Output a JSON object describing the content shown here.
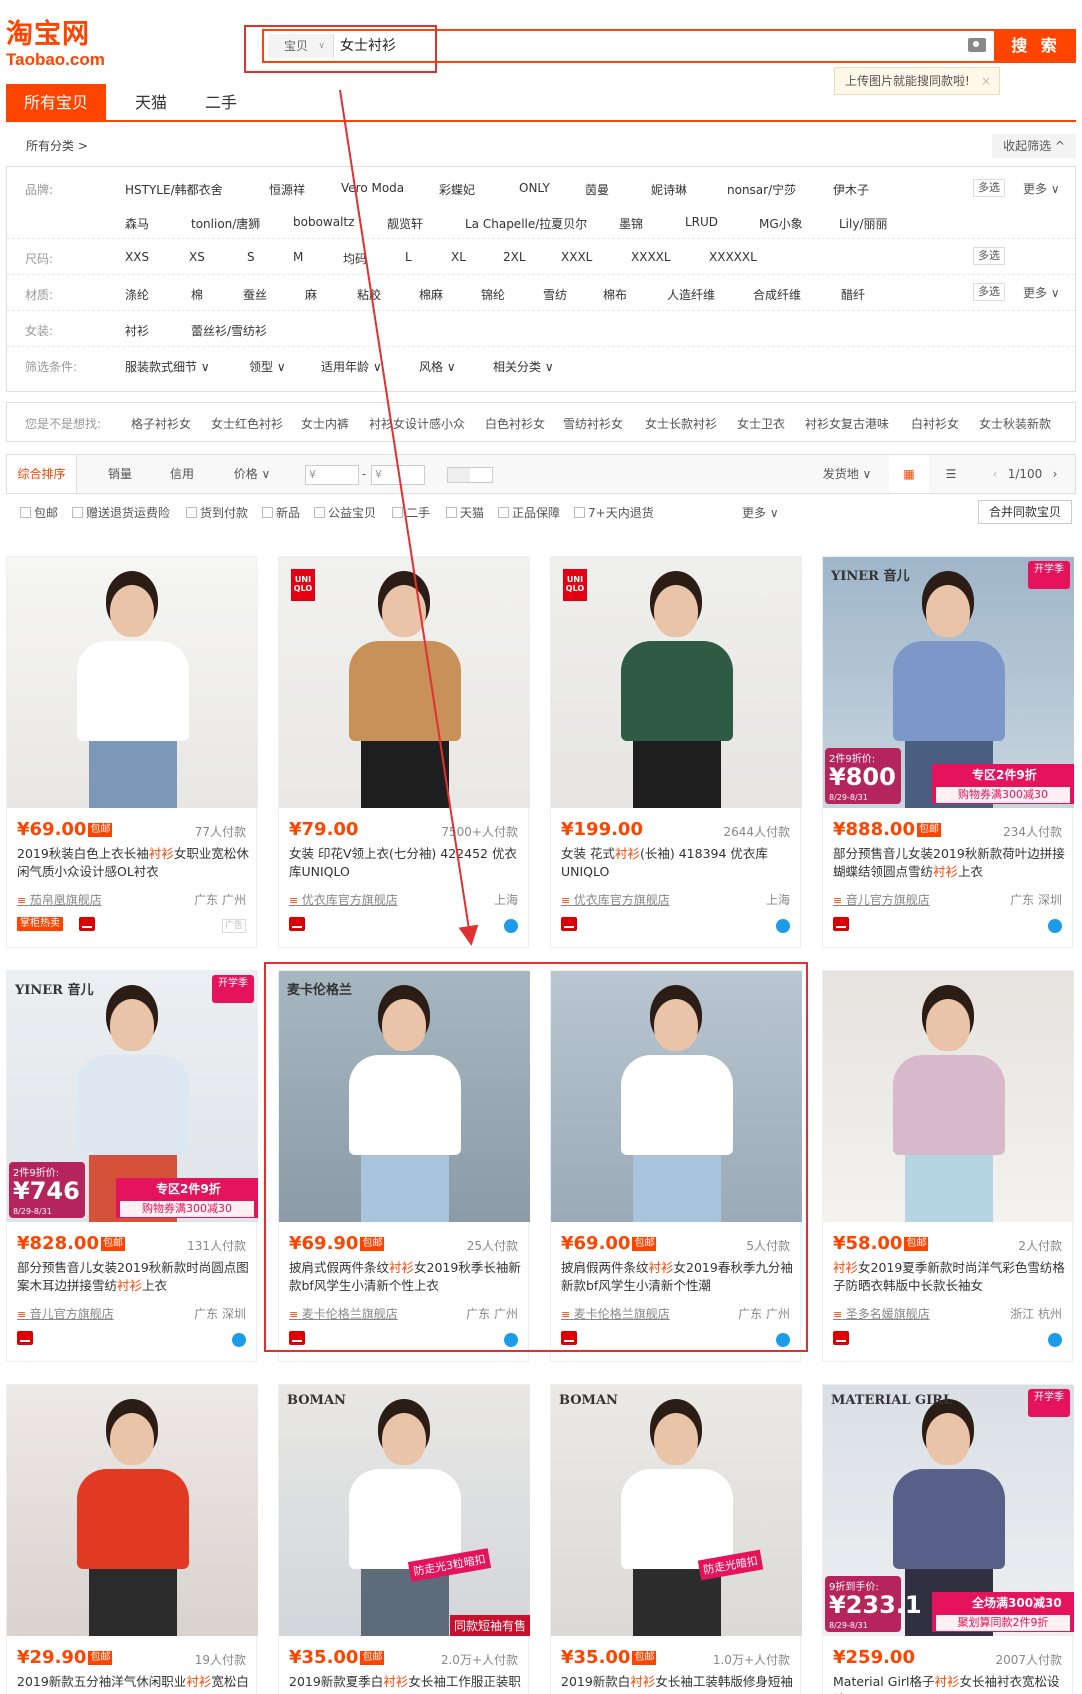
{
  "header": {
    "logo_cn": "淘宝网",
    "logo_en": "Taobao.com",
    "search_scope": "宝贝",
    "search_query": "女士衬衫",
    "search_button": "搜 索",
    "tip": "上传图片就能搜同款啦!",
    "tip_close": "×"
  },
  "tabs": [
    {
      "label": "所有宝贝"
    },
    {
      "label": "天猫"
    },
    {
      "label": "二手"
    }
  ],
  "category": {
    "all": "所有分类 >",
    "collapse": "收起筛选 ^"
  },
  "filters": {
    "brand_label": "品牌:",
    "brands_row1": [
      "HSTYLE/韩都衣舍",
      "恒源祥",
      "Vero Moda",
      "彩蝶妃",
      "ONLY",
      "茵曼",
      "妮诗琳",
      "nonsar/宁莎",
      "伊木子"
    ],
    "brands_row2": [
      "森马",
      "tonlion/唐狮",
      "bobowaltz",
      "靓览轩",
      "La Chapelle/拉夏贝尔",
      "墨锦",
      "LRUD",
      "MG小象",
      "Lily/丽丽"
    ],
    "size_label": "尺码:",
    "sizes": [
      "XXS",
      "XS",
      "S",
      "M",
      "均码",
      "L",
      "XL",
      "2XL",
      "XXXL",
      "XXXXL",
      "XXXXXL"
    ],
    "material_label": "材质:",
    "materials": [
      "涤纶",
      "棉",
      "蚕丝",
      "麻",
      "粘胶",
      "棉麻",
      "锦纶",
      "雪纺",
      "棉布",
      "人造纤维",
      "合成纤维",
      "醋纤"
    ],
    "women_label": "女装:",
    "women": [
      "衬衫",
      "蕾丝衫/雪纺衫"
    ],
    "cond_label": "筛选条件:",
    "conds": [
      "服装款式细节",
      "领型",
      "适用年龄",
      "风格",
      "相关分类"
    ],
    "multi": "多选",
    "more": "更多"
  },
  "suggest": {
    "label": "您是不是想找:",
    "items": [
      "格子衬衫女",
      "女士红色衬衫",
      "女士内裤",
      "衬衫女设计感小众",
      "白色衬衫女",
      "雪纺衬衫女",
      "女士长款衬衫",
      "女士卫衣",
      "衬衫女复古港味",
      "白衬衫女",
      "女士秋装新款"
    ]
  },
  "sort": {
    "items": [
      "综合排序",
      "销量",
      "信用",
      "价格"
    ],
    "price_from": "¥",
    "price_to": "¥",
    "ship": "发货地",
    "page": "1/100",
    "dash": "-"
  },
  "checks": [
    "包邮",
    "赠送退货运费险",
    "货到付款",
    "新品",
    "公益宝贝",
    "二手",
    "天猫",
    "正品保障",
    "7+天内退货"
  ],
  "checks_more": "更多",
  "merge": "合并同款宝贝",
  "items": [
    {
      "price": "¥69.00",
      "baoyou": "包邮",
      "sales": "77人付款",
      "t1": "2019秋装白色上衣长袖",
      "h": "衬衫",
      "t2": "女职业宽松休闲气质小众设计感OL衬衣",
      "shop": "茄帛凰旗舰店",
      "loc": "广东 广州",
      "tag": "掌柜热卖",
      "ad": "广告"
    },
    {
      "price": "¥79.00",
      "baoyou": "",
      "sales": "7500+人付款",
      "t1": "女装 印花V领上衣(七分袖) 422452 优衣库UNIQLO",
      "h": "",
      "t2": "",
      "shop": "优衣库官方旗舰店",
      "loc": "上海",
      "brand": "UNI QLO"
    },
    {
      "price": "¥199.00",
      "baoyou": "",
      "sales": "2644人付款",
      "t1": "女装 花式",
      "h": "衬衫",
      "t2": "(长袖) 418394 优衣库UNIQLO",
      "shop": "优衣库官方旗舰店",
      "loc": "上海",
      "brand": "UNI QLO"
    },
    {
      "price": "¥888.00",
      "baoyou": "包邮",
      "sales": "234人付款",
      "t1": "部分预售音儿女装2019秋新款荷叶边拼接蝴蝶结领圆点雪纺",
      "h": "衬衫",
      "t2": "上衣",
      "shop": "音儿官方旗舰店",
      "loc": "广东 深圳",
      "logo": "YINER 音儿",
      "p1": "2件9折价:",
      "p2": "¥800",
      "p3": "8/29-8/31",
      "p4": "专区2件9折",
      "p5": "购物券满300减30",
      "season": "开学季"
    },
    {
      "price": "¥828.00",
      "baoyou": "包邮",
      "sales": "131人付款",
      "t1": "部分预售音儿女装2019秋新款时尚圆点图案木耳边拼接雪纺",
      "h": "衬衫",
      "t2": "上衣",
      "shop": "音儿官方旗舰店",
      "loc": "广东 深圳",
      "logo": "YINER 音儿",
      "p1": "2件9折价:",
      "p2": "¥746",
      "p3": "8/29-8/31",
      "p4": "专区2件9折",
      "p5": "购物券满300减30",
      "season": "开学季"
    },
    {
      "price": "¥69.90",
      "baoyou": "包邮",
      "sales": "25人付款",
      "t1": "披肩式假两件条纹",
      "h": "衬衫",
      "t2": "女2019秋季长袖新款bf风学生小清新个性上衣",
      "shop": "麦卡伦格兰旗舰店",
      "loc": "广东 广州",
      "logo": "麦卡伦格兰"
    },
    {
      "price": "¥69.00",
      "baoyou": "包邮",
      "sales": "5人付款",
      "t1": "披肩假两件条纹",
      "h": "衬衫",
      "t2": "女2019春秋季九分袖新款bf风学生小清新个性潮",
      "shop": "麦卡伦格兰旗舰店",
      "loc": "广东 广州"
    },
    {
      "price": "¥58.00",
      "baoyou": "包邮",
      "sales": "2人付款",
      "t1": "",
      "h": "衬衫",
      "t2": "女2019夏季新款时尚洋气彩色雪纺格子防晒衣韩版中长款长袖女",
      "shop": "圣多名媛旗舰店",
      "loc": "浙江 杭州"
    },
    {
      "price": "¥29.90",
      "baoyou": "包邮",
      "sales": "19人付款",
      "t1": "2019新款五分袖洋气休闲职业",
      "h": "衬衫",
      "t2": "宽松白",
      "shop": "",
      "loc": ""
    },
    {
      "price": "¥35.00",
      "baoyou": "包邮",
      "sales": "2.0万+人付款",
      "t1": "2019新款夏季白",
      "h": "衬衫",
      "t2": "女长袖工作服正装职",
      "shop": "",
      "loc": "",
      "logo": "BOMAN",
      "badge1": "防走光3粒暗扣",
      "badge2": "同款短袖有售"
    },
    {
      "price": "¥35.00",
      "baoyou": "包邮",
      "sales": "1.0万+人付款",
      "t1": "2019新款白",
      "h": "衬衫",
      "t2": "女长袖工装韩版修身短袖",
      "shop": "",
      "loc": "",
      "logo": "BOMAN",
      "badge1": "防走光暗扣"
    },
    {
      "price": "¥259.00",
      "baoyou": "",
      "sales": "2007人付款",
      "t1": "Material Girl格子",
      "h": "衬衫",
      "t2": "女长袖衬衣宽松设计",
      "shop": "",
      "loc": "",
      "logo": "MATERIAL GIRL",
      "p1": "9折到手价:",
      "p2": "¥233.1",
      "p3": "8/29-8/31",
      "p4": "全场满300减30",
      "p5": "聚划算同款2件9折",
      "season": "开学季"
    }
  ]
}
